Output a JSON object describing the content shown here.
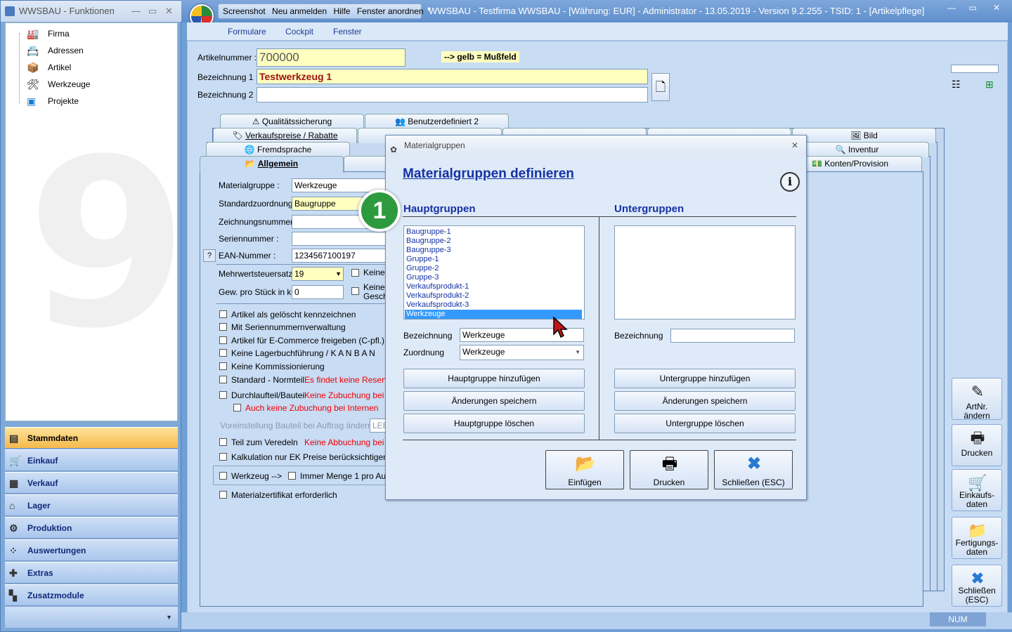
{
  "left_window": {
    "title": "WWSBAU - Funktionen",
    "tree": [
      {
        "label": "Firma",
        "icon": "factory-icon"
      },
      {
        "label": "Adressen",
        "icon": "address-card-icon"
      },
      {
        "label": "Artikel",
        "icon": "box-icon"
      },
      {
        "label": "Werkzeuge",
        "icon": "tools-icon"
      },
      {
        "label": "Projekte",
        "icon": "project-icon"
      }
    ],
    "nav": [
      {
        "label": "Stammdaten",
        "active": true
      },
      {
        "label": "Einkauf"
      },
      {
        "label": "Verkauf"
      },
      {
        "label": "Lager"
      },
      {
        "label": "Produktion"
      },
      {
        "label": "Auswertungen"
      },
      {
        "label": "Extras"
      },
      {
        "label": "Zusatzmodule"
      }
    ]
  },
  "main_window": {
    "menu": [
      "Screenshot",
      "Neu anmelden",
      "Hilfe",
      "Fenster anordnen"
    ],
    "title": "WWSBAU - Testfirma WWSBAU - [Währung: EUR] - Administrator - 13.05.2019 - Version 9.2.255 - TSID: 1  - [Artikelpflege]",
    "ribbon": [
      "Formulare",
      "Cockpit",
      "Fenster"
    ],
    "status": {
      "num": "NUM"
    }
  },
  "form": {
    "artikelnummer_label": "Artikelnummer :",
    "artikelnummer": "700000",
    "mussfeld_hint": "--> gelb = Mußfeld",
    "bez1_label": "Bezeichnung 1 :",
    "bez1": "Testwerkzeug 1",
    "bez2_label": "Bezeichnung 2 :",
    "bez2": "",
    "tabs_row1": [
      "Qualitätssicherung",
      "Benutzerdefiniert 2"
    ],
    "tabs_row2": [
      "Verkaufspreise / Rabatte",
      "Bild"
    ],
    "tabs_row3": [
      "Fremdsprache",
      "Inventur"
    ],
    "tabs_row4": [
      "Allgemein",
      "Konten/Provision"
    ],
    "materialgruppe_label": "Materialgruppe :",
    "materialgruppe": "Werkzeuge",
    "standardzuordnung_label": "Standardzuordnung :",
    "standardzuordnung": "Baugruppe",
    "zeichnungsnummer_label": "Zeichnungsnummer :",
    "seriennummer_label": "Seriennummer :",
    "ean_label": "EAN-Nummer :",
    "ean": "1234567100197",
    "ean_help": "?",
    "mwst_label": "Mehrwertsteuersatz :",
    "mwst": "19",
    "keine1": "Keine",
    "gewicht_label": "Gew. pro Stück in kg:",
    "gewicht": "0",
    "keine2": "Keine",
    "gesch": "Gesch",
    "checks": [
      "Artikel als gelöscht kennzeichnen",
      "Mit Seriennummernverwaltung",
      "Artikel für E-Commerce freigeben (C-pfl.)",
      "Keine Lagerbuchführung / K A N B A N",
      "Keine Kommissionierung",
      "Standard - Normteil",
      "Durchlaufteil/Bauteil"
    ],
    "standard_note": "Es findet keine Reservie",
    "durchlauf_note": "Keine Zubuchung bei Fe",
    "auch_keine": "Auch keine Zubuchung bei Internen",
    "voreinstellung_label": "Voreinstellung Bauteil bei Auftrag ändern",
    "voreinstellung": "LEE",
    "veredeln": "Teil zum Veredeln",
    "veredeln_note": "Keine Abbuchung bei Fe",
    "kalkulation": "Kalkulation nur EK Preise berücksichtigen",
    "werkzeug": "Werkzeug -->",
    "immer_menge": "Immer Menge 1 pro Auftra",
    "zertifikat": "Materialzertifikat erforderlich"
  },
  "side_buttons": [
    {
      "label": "ArtNr. ändern",
      "icon": "edit-icon"
    },
    {
      "label": "Drucken",
      "icon": "printer-icon"
    },
    {
      "label": "Einkaufs-\ndaten",
      "icon": "cart-icon"
    },
    {
      "label": "Fertigungs-\ndaten",
      "icon": "folder-icon"
    },
    {
      "label": "Schließen\n(ESC)",
      "icon": "close-icon"
    }
  ],
  "dialog": {
    "title": "Materialgruppen",
    "heading": "Materialgruppen definieren",
    "hauptgruppen": "Hauptgruppen",
    "untergruppen": "Untergruppen",
    "items": [
      "Baugruppe-1",
      "Baugruppe-2",
      "Baugruppe-3",
      "Gruppe-1",
      "Gruppe-2",
      "Gruppe-3",
      "Verkaufsprodukt-1",
      "Verkaufsprodukt-2",
      "Verkaufsprodukt-3",
      "Werkzeuge"
    ],
    "selected": "Werkzeuge",
    "bezeichnung_label": "Bezeichnung",
    "bezeichnung": "Werkzeuge",
    "zuordnung_label": "Zuordnung",
    "zuordnung": "Werkzeuge",
    "u_bezeichnung_label": "Bezeichnung",
    "u_bezeichnung": "",
    "btn_haupt_add": "Hauptgruppe hinzufügen",
    "btn_save1": "Änderungen speichern",
    "btn_haupt_del": "Hauptgruppe löschen",
    "btn_unter_add": "Untergruppe hinzufügen",
    "btn_save2": "Änderungen speichern",
    "btn_unter_del": "Untergruppe löschen",
    "btn_einfuegen": "Einfügen",
    "btn_drucken": "Drucken",
    "btn_schliessen": "Schließen (ESC)",
    "badge": "1"
  },
  "colors": {
    "accent": "#1432a4",
    "selection": "#3399ff",
    "required": "#ffffc0",
    "badge": "#2e9a3e"
  }
}
